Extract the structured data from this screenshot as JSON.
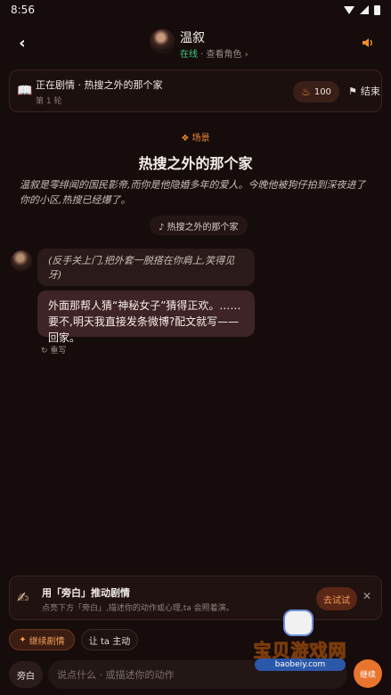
{
  "status": {
    "time": "8:56"
  },
  "header": {
    "name": "温叙",
    "online": "在线",
    "separator": " · ",
    "view_role": "查看角色 ›"
  },
  "plot": {
    "title": "正在剧情 · 热搜之外的那个家",
    "round": "第 1 轮",
    "heat": "100",
    "end_label": "结束"
  },
  "scene": {
    "tag": "❖ 场景",
    "title": "热搜之外的那个家",
    "description": "温叙是零绯闻的国民影帝,而你是他隐婚多年的爱人。今晚他被狗仔拍到深夜进了你的小区,热搜已经爆了。",
    "music": "♪ 热搜之外的那个家"
  },
  "messages": {
    "action": "(反手关上门,把外套一脱搭在你肩上,笑得见牙)",
    "speech": "外面那帮人猜“神秘女子”猜得正欢。……要不,明天我直接发条微博?配文就写——回家。",
    "regenerate": "↻ 重写"
  },
  "narration": {
    "title": "用「旁白」推动剧情",
    "subtitle": "点亮下方「旁白」,描述你的动作或心理,ta 会照着演。",
    "try_label": "去试试"
  },
  "chips": {
    "continue": "继续剧情",
    "let_ta": "让 ta 主动"
  },
  "input": {
    "aside_label": "旁白",
    "placeholder": "说点什么 · 或描述你的动作",
    "send_label": "继续"
  },
  "watermark": {
    "text": "宝贝游戏网",
    "url": "baobeiy.com"
  },
  "colors": {
    "background": "#160c0c",
    "accent": "#f08a2c",
    "online": "#3fc97a"
  }
}
